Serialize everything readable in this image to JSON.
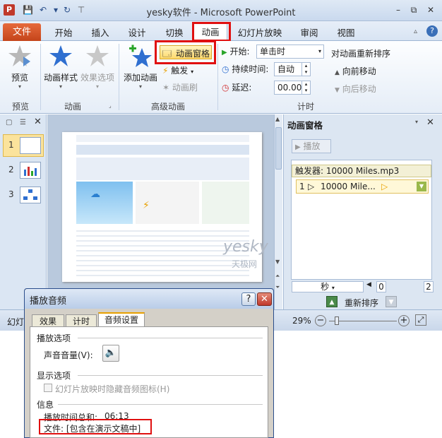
{
  "window": {
    "title": "yesky软件 - Microsoft PowerPoint",
    "app_icon": "P",
    "colors": {
      "accent_red": "#e01010",
      "file_tab": "#d7531f",
      "ribbon_blue": "#dce6f2"
    }
  },
  "quick_access": [
    "save-icon",
    "undo-icon",
    "redo-icon",
    "customize-icon"
  ],
  "tabs": {
    "file": "文件",
    "items": [
      "开始",
      "插入",
      "设计",
      "切换",
      "动画",
      "幻灯片放映",
      "审阅",
      "视图"
    ],
    "active": "动画"
  },
  "ribbon": {
    "preview_group": {
      "button": "预览",
      "label": "预览"
    },
    "animation_group": {
      "style_button": "动画样式",
      "effect_button": "效果选项",
      "label": "动画"
    },
    "advanced_group": {
      "add_button": "添加动画",
      "pane_button": "动画窗格",
      "trigger_button": "触发",
      "painter_button": "动画刷",
      "label": "高级动画"
    },
    "timing_group": {
      "start_label": "开始:",
      "start_value": "单击时",
      "duration_label": "持续时间:",
      "duration_value": "自动",
      "delay_label": "延迟:",
      "delay_value": "00.00",
      "reorder_title": "对动画重新排序",
      "move_earlier": "向前移动",
      "move_later": "向后移动",
      "label": "计时"
    }
  },
  "slides": [
    {
      "num": "1",
      "selected": true
    },
    {
      "num": "2",
      "selected": false
    },
    {
      "num": "3",
      "selected": false
    }
  ],
  "slide_preview": {
    "site_name": "天极网"
  },
  "animation_pane": {
    "title": "动画窗格",
    "play_button": "播放",
    "trigger_text": "触发器: 10000 Miles.mp3",
    "item_num": "1",
    "item_label": "10000 Mile...",
    "time_unit": "秒",
    "timeline_start": "0",
    "timeline_end": "2",
    "reorder_label": "重新排序"
  },
  "statusbar": {
    "left_text": "幻灯",
    "zoom": "29%"
  },
  "watermark": {
    "brand": "yesky",
    "sub": "天极网"
  },
  "dialog": {
    "title": "播放音频",
    "tabs": [
      "效果",
      "计时",
      "音频设置"
    ],
    "active_tab": "音频设置",
    "section_play": "播放选项",
    "volume_label": "声音音量(V):",
    "section_display": "显示选项",
    "hide_icon_label": "幻灯片放映时隐藏音频图标(H)",
    "section_info": "信息",
    "total_time_label": "播放时间总和:",
    "total_time_value": "06:13",
    "file_text": "文件: [包含在演示文稿中]"
  }
}
